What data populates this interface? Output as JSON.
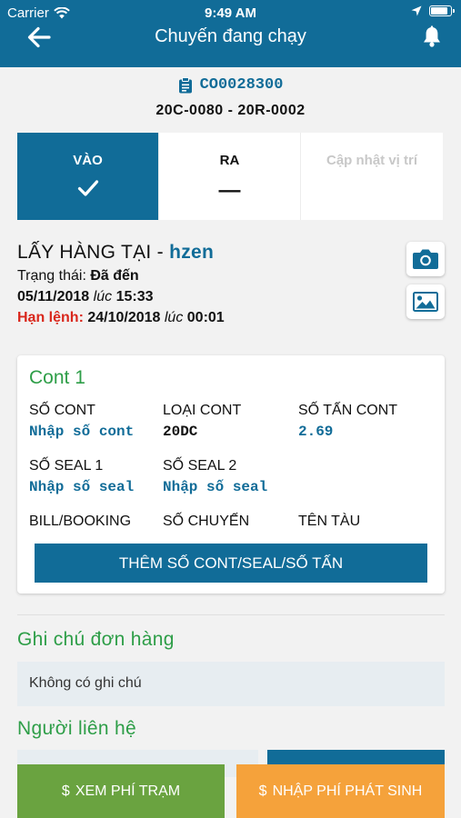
{
  "status_bar": {
    "carrier": "Carrier",
    "time": "9:49 AM"
  },
  "header": {
    "title": "Chuyến đang chạy"
  },
  "order": {
    "code": "CO0028300",
    "plates": "20C-0080 - 20R-0002"
  },
  "tabs": [
    {
      "label": "VÀO",
      "mark": "✓",
      "state": "active"
    },
    {
      "label": "RA",
      "mark": "—",
      "state": "pending"
    },
    {
      "label": "Cập nhật vị trí",
      "mark": "",
      "state": "disabled"
    }
  ],
  "pickup": {
    "title_prefix": "LẤY HÀNG TẠI - ",
    "place": "hzen",
    "status_label": "Trạng thái:",
    "status_value": "Đã đến",
    "date": "05/11/2018",
    "at": "lúc",
    "time": "15:33",
    "deadline_label": "Hạn lệnh:",
    "deadline_date": "24/10/2018",
    "deadline_time": "00:01"
  },
  "cont": {
    "title": "Cont 1",
    "fields": {
      "so_cont": {
        "label": "SỐ CONT",
        "value": "Nhập số cont"
      },
      "loai_cont": {
        "label": "LOẠI CONT",
        "value": "20DC"
      },
      "so_tan": {
        "label": "SỐ TẤN CONT",
        "value": "2.69"
      },
      "seal1": {
        "label": "SỐ SEAL 1",
        "value": "Nhập số seal"
      },
      "seal2": {
        "label": "SỐ SEAL 2",
        "value": "Nhập số seal"
      },
      "bill": {
        "label": "BILL/BOOKING"
      },
      "so_chuyen": {
        "label": "SỐ CHUYẾN"
      },
      "ten_tau": {
        "label": "TÊN TÀU"
      }
    },
    "add_button": "THÊM SỐ CONT/SEAL/SỐ TẤN"
  },
  "note": {
    "title": "Ghi chú đơn hàng",
    "text": "Không có ghi chú"
  },
  "contact": {
    "title": "Người liên hệ"
  },
  "bottom": {
    "view_fee": "XEM PHÍ TRẠM",
    "add_fee": "NHẬP PHÍ PHÁT SINH",
    "currency_symbol": "$"
  },
  "colors": {
    "primary": "#116c98",
    "green": "#2e9e48",
    "red": "#d9271c",
    "fee_view": "#6aa340",
    "fee_add": "#f5a23b"
  }
}
